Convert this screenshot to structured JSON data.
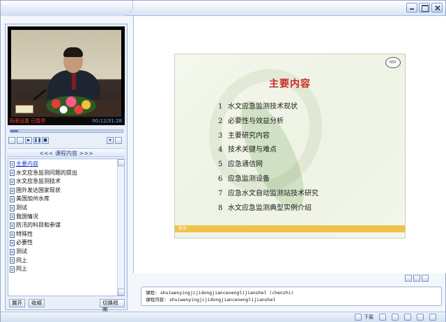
{
  "window": {
    "controls": [
      "minimize",
      "maximize",
      "close"
    ]
  },
  "video": {
    "status_left": "码率设置  已暂停",
    "time": "00:12/31:28",
    "progress_fraction": 0.07
  },
  "player_controls": [
    "prev-icon",
    "rewind-icon",
    "play-icon",
    "pause-icon",
    "stop-icon",
    "bookmark-icon",
    "volume-icon",
    "fullscreen-icon"
  ],
  "playlist": {
    "header": "<<< 课程内容 >>>",
    "items": [
      {
        "label": "主要内容",
        "active": true
      },
      {
        "label": "水文应急监测问题的提出",
        "active": false
      },
      {
        "label": "水文应急监测技术",
        "active": false
      },
      {
        "label": "国外发达国家现状",
        "active": false
      },
      {
        "label": "美国加州水库",
        "active": false
      },
      {
        "label": "测试",
        "active": false
      },
      {
        "label": "我国情况",
        "active": false
      },
      {
        "label": "防汛的科目和参谋",
        "active": false
      },
      {
        "label": "特殊性",
        "active": false
      },
      {
        "label": "必要性",
        "active": false
      },
      {
        "label": "测试",
        "active": false
      },
      {
        "label": "同上",
        "active": false
      },
      {
        "label": "同上",
        "active": false
      }
    ]
  },
  "left_buttons": {
    "expand": "展开",
    "collapse": "收缩",
    "switch_view": "切换视图"
  },
  "slide": {
    "title": "主要内容",
    "logo_text": "NSY",
    "footer_text": "南水",
    "items": [
      {
        "num": "1",
        "text": "水文应急监测技术现状"
      },
      {
        "num": "2",
        "text": "必要性与效益分析"
      },
      {
        "num": "3",
        "text": "主要研究内容"
      },
      {
        "num": "4",
        "text": "技术关键与难点"
      },
      {
        "num": "5",
        "text": "应急通信网"
      },
      {
        "num": "6",
        "text": "应急监测设备"
      },
      {
        "num": "7",
        "text": "应急水文自动监测站技术研究"
      },
      {
        "num": "8",
        "text": "水文应急监测典型实例介绍"
      }
    ]
  },
  "course_info": {
    "course_line": "课程: shuiwenyingjijidongjiancenenglijianshel (chenzhi)",
    "content_line": "课程内容: shuiwenyingjijidongjiancenenglijianshel"
  },
  "statusbar": {
    "download": "下载"
  },
  "colors": {
    "accent_blue": "#5c86c8",
    "slide_title_red": "#cc2a20",
    "slide_footer_yellow": "#f0c24a",
    "video_status_red": "#ff3a3a"
  }
}
